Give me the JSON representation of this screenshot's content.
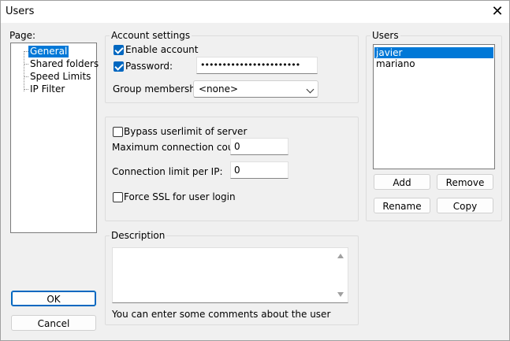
{
  "window": {
    "title": "Users",
    "close_glyph": "✕"
  },
  "page": {
    "label": "Page:",
    "items": [
      {
        "label": "General",
        "selected": true
      },
      {
        "label": "Shared folders",
        "selected": false
      },
      {
        "label": "Speed Limits",
        "selected": false
      },
      {
        "label": "IP Filter",
        "selected": false
      }
    ]
  },
  "account": {
    "group_label": "Account settings",
    "enable_label": "Enable account",
    "enable_checked": true,
    "password_label": "Password:",
    "password_checked": true,
    "password_value": "•••••••••••••••••••••••",
    "group_membership_label": "Group membership:",
    "group_membership_value": "<none>"
  },
  "limits": {
    "bypass_label": "Bypass userlimit of server",
    "bypass_checked": false,
    "max_conn_label": "Maximum connection count:",
    "max_conn_value": "0",
    "conn_per_ip_label": "Connection limit per IP:",
    "conn_per_ip_value": "0",
    "force_ssl_label": "Force SSL for user login",
    "force_ssl_checked": false
  },
  "description": {
    "group_label": "Description",
    "value": "",
    "hint": "You can enter some comments about the user"
  },
  "users": {
    "group_label": "Users",
    "items": [
      {
        "name": "javier",
        "selected": true
      },
      {
        "name": "mariano",
        "selected": false
      }
    ],
    "add_label": "Add",
    "remove_label": "Remove",
    "rename_label": "Rename",
    "copy_label": "Copy"
  },
  "footer": {
    "ok_label": "OK",
    "cancel_label": "Cancel"
  },
  "colors": {
    "accent": "#0078d7",
    "checkbox": "#0067c0",
    "background": "#f0f0f0"
  }
}
